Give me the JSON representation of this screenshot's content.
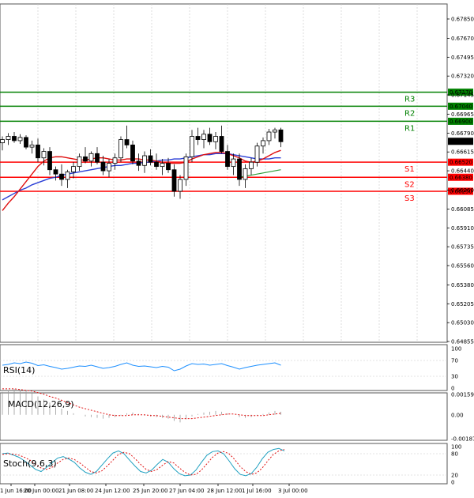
{
  "chart_data": {
    "type": "candlestick",
    "price_axis": {
      "range": [
        0.64855,
        0.67903
      ],
      "ticks": [
        "0.67850",
        "0.67670",
        "0.67495",
        "0.67320",
        "0.67145",
        "0.66965",
        "0.66790",
        "0.66615",
        "0.66440",
        "0.66260",
        "0.66085",
        "0.65910",
        "0.65735",
        "0.65560",
        "0.65380",
        "0.65205",
        "0.65030",
        "0.64855"
      ]
    },
    "time_labels": [
      "1 Jun 16:00",
      "20 Jun 00:00",
      "21 Jun 08:00",
      "24 Jun 12:00",
      "25 Jun 20:00",
      "27 Jun 04:00",
      "28 Jun 12:00",
      "1 Jul 16:00",
      "3 Jul 00:00"
    ],
    "current_price": "0.66714",
    "levels": [
      {
        "name": "R3",
        "value": 0.6717,
        "value_label": "0.67170",
        "color": "#008000"
      },
      {
        "name": "R2",
        "value": 0.6704,
        "value_label": "0.67040",
        "color": "#008000"
      },
      {
        "name": "R1",
        "value": 0.669,
        "value_label": "0.66900",
        "color": "#008000"
      },
      {
        "name": "S1",
        "value": 0.6652,
        "value_label": "0.66520",
        "color": "#ff0000"
      },
      {
        "name": "S2",
        "value": 0.6638,
        "value_label": "0.66380",
        "color": "#ff0000"
      },
      {
        "name": "S3",
        "value": 0.6625,
        "value_label": "0.66250",
        "color": "#ff0000"
      }
    ],
    "candles": [
      {
        "o": 0.667,
        "h": 0.6676,
        "l": 0.6663,
        "c": 0.6673
      },
      {
        "o": 0.6673,
        "h": 0.6679,
        "l": 0.6668,
        "c": 0.6676
      },
      {
        "o": 0.6676,
        "h": 0.668,
        "l": 0.667,
        "c": 0.6672
      },
      {
        "o": 0.6672,
        "h": 0.6678,
        "l": 0.6669,
        "c": 0.6675
      },
      {
        "o": 0.6675,
        "h": 0.6677,
        "l": 0.6664,
        "c": 0.6666
      },
      {
        "o": 0.6666,
        "h": 0.6672,
        "l": 0.666,
        "c": 0.6668
      },
      {
        "o": 0.6668,
        "h": 0.6674,
        "l": 0.6652,
        "c": 0.6656
      },
      {
        "o": 0.6656,
        "h": 0.6665,
        "l": 0.6649,
        "c": 0.6662
      },
      {
        "o": 0.6662,
        "h": 0.6666,
        "l": 0.664,
        "c": 0.6645
      },
      {
        "o": 0.6645,
        "h": 0.6648,
        "l": 0.6635,
        "c": 0.6641
      },
      {
        "o": 0.6641,
        "h": 0.665,
        "l": 0.663,
        "c": 0.6636
      },
      {
        "o": 0.6636,
        "h": 0.6645,
        "l": 0.6628,
        "c": 0.6643
      },
      {
        "o": 0.6643,
        "h": 0.6652,
        "l": 0.6637,
        "c": 0.6648
      },
      {
        "o": 0.6648,
        "h": 0.666,
        "l": 0.6644,
        "c": 0.6657
      },
      {
        "o": 0.6657,
        "h": 0.6666,
        "l": 0.6651,
        "c": 0.6653
      },
      {
        "o": 0.6653,
        "h": 0.6662,
        "l": 0.6648,
        "c": 0.666
      },
      {
        "o": 0.666,
        "h": 0.6666,
        "l": 0.665,
        "c": 0.6652
      },
      {
        "o": 0.6652,
        "h": 0.6658,
        "l": 0.664,
        "c": 0.6644
      },
      {
        "o": 0.6644,
        "h": 0.6655,
        "l": 0.6638,
        "c": 0.6651
      },
      {
        "o": 0.6651,
        "h": 0.666,
        "l": 0.6645,
        "c": 0.6656
      },
      {
        "o": 0.6656,
        "h": 0.6676,
        "l": 0.6652,
        "c": 0.6673
      },
      {
        "o": 0.6673,
        "h": 0.6686,
        "l": 0.6665,
        "c": 0.6668
      },
      {
        "o": 0.6668,
        "h": 0.6672,
        "l": 0.665,
        "c": 0.6653
      },
      {
        "o": 0.6653,
        "h": 0.666,
        "l": 0.6644,
        "c": 0.6649
      },
      {
        "o": 0.6649,
        "h": 0.6662,
        "l": 0.6642,
        "c": 0.6658
      },
      {
        "o": 0.6658,
        "h": 0.6664,
        "l": 0.6649,
        "c": 0.6652
      },
      {
        "o": 0.6652,
        "h": 0.666,
        "l": 0.6645,
        "c": 0.6648
      },
      {
        "o": 0.6648,
        "h": 0.6655,
        "l": 0.664,
        "c": 0.6651
      },
      {
        "o": 0.6651,
        "h": 0.6656,
        "l": 0.6642,
        "c": 0.6645
      },
      {
        "o": 0.6645,
        "h": 0.665,
        "l": 0.662,
        "c": 0.6625
      },
      {
        "o": 0.6625,
        "h": 0.664,
        "l": 0.6618,
        "c": 0.6636
      },
      {
        "o": 0.6636,
        "h": 0.666,
        "l": 0.663,
        "c": 0.6657
      },
      {
        "o": 0.6657,
        "h": 0.6682,
        "l": 0.6652,
        "c": 0.6676
      },
      {
        "o": 0.6676,
        "h": 0.6684,
        "l": 0.6668,
        "c": 0.6673
      },
      {
        "o": 0.6673,
        "h": 0.6682,
        "l": 0.6665,
        "c": 0.6678
      },
      {
        "o": 0.6678,
        "h": 0.6684,
        "l": 0.6668,
        "c": 0.6671
      },
      {
        "o": 0.6671,
        "h": 0.668,
        "l": 0.6664,
        "c": 0.6676
      },
      {
        "o": 0.6676,
        "h": 0.6686,
        "l": 0.666,
        "c": 0.6662
      },
      {
        "o": 0.6662,
        "h": 0.6668,
        "l": 0.6645,
        "c": 0.6648
      },
      {
        "o": 0.6648,
        "h": 0.666,
        "l": 0.664,
        "c": 0.6655
      },
      {
        "o": 0.6655,
        "h": 0.666,
        "l": 0.663,
        "c": 0.6636
      },
      {
        "o": 0.6636,
        "h": 0.665,
        "l": 0.6628,
        "c": 0.6646
      },
      {
        "o": 0.6646,
        "h": 0.6656,
        "l": 0.664,
        "c": 0.6652
      },
      {
        "o": 0.6652,
        "h": 0.667,
        "l": 0.6648,
        "c": 0.6667
      },
      {
        "o": 0.6667,
        "h": 0.6675,
        "l": 0.666,
        "c": 0.6672
      },
      {
        "o": 0.6672,
        "h": 0.6683,
        "l": 0.6668,
        "c": 0.668
      },
      {
        "o": 0.668,
        "h": 0.6684,
        "l": 0.6674,
        "c": 0.6682
      },
      {
        "o": 0.6682,
        "h": 0.6684,
        "l": 0.6666,
        "c": 0.6671
      }
    ],
    "ma_red": [
      0.6607,
      0.6614,
      0.662,
      0.6627,
      0.6634,
      0.6641,
      0.6648,
      0.6653,
      0.6656,
      0.6657,
      0.6657,
      0.6656,
      0.6655,
      0.6654,
      0.6654,
      0.6655,
      0.6656,
      0.6656,
      0.6655,
      0.6654,
      0.6654,
      0.6655,
      0.6655,
      0.6655,
      0.6654,
      0.6654,
      0.6653,
      0.6652,
      0.6651,
      0.6651,
      0.6651,
      0.6652,
      0.6655,
      0.6657,
      0.6659,
      0.666,
      0.6661,
      0.6661,
      0.666,
      0.6658,
      0.6656,
      0.6653,
      0.6652,
      0.6653,
      0.6655,
      0.6658,
      0.6661,
      0.6663
    ],
    "ma_blue": [
      0.6617,
      0.662,
      0.6623,
      0.6626,
      0.6628,
      0.6631,
      0.6633,
      0.6635,
      0.6637,
      0.6638,
      0.664,
      0.6641,
      0.6642,
      0.6643,
      0.6644,
      0.6645,
      0.6646,
      0.6647,
      0.6648,
      0.6649,
      0.6649,
      0.665,
      0.6651,
      0.6651,
      0.6652,
      0.6652,
      0.6653,
      0.6654,
      0.6654,
      0.6655,
      0.6655,
      0.6656,
      0.6657,
      0.6658,
      0.6659,
      0.6659,
      0.666,
      0.666,
      0.666,
      0.6659,
      0.6658,
      0.6657,
      0.6656,
      0.6655,
      0.6655,
      0.6655,
      0.6656,
      0.6656
    ],
    "ma_green": [
      0.6638,
      0.6639,
      0.664,
      0.6641,
      0.6642,
      0.6643,
      0.6644,
      0.6645
    ],
    "rsi": {
      "title": "RSI(14)",
      "range": [
        0,
        100
      ],
      "ticks": [
        "100",
        "70",
        "30",
        "0"
      ],
      "values": [
        58,
        60,
        64,
        62,
        66,
        63,
        57,
        59,
        55,
        52,
        48,
        50,
        53,
        56,
        55,
        58,
        54,
        50,
        52,
        55,
        60,
        64,
        58,
        55,
        56,
        54,
        52,
        55,
        53,
        44,
        48,
        56,
        62,
        60,
        61,
        58,
        60,
        62,
        57,
        53,
        48,
        52,
        55,
        58,
        60,
        62,
        64,
        58
      ]
    },
    "macd": {
      "title": "MACD(12,26,9)",
      "range": [
        -0.001876,
        0.001598
      ],
      "ticks": [
        "0.001598",
        "0.00",
        "-0.001876"
      ],
      "histogram": [
        0.0003,
        0.00032,
        0.00034,
        0.00033,
        0.00031,
        0.00028,
        0.00024,
        0.0002,
        0.00016,
        0.00012,
        8e-05,
        5e-05,
        2e-05,
        0.0,
        -2e-05,
        -3e-05,
        -4e-05,
        -5e-05,
        -4e-05,
        -3e-05,
        -1e-05,
        2e-05,
        3e-05,
        1e-05,
        -1e-05,
        -2e-05,
        -3e-05,
        -4e-05,
        -5e-05,
        -8e-05,
        -0.0001,
        -6e-05,
        -2e-05,
        1e-05,
        3e-05,
        4e-05,
        5e-05,
        4e-05,
        2e-05,
        0.0,
        -3e-05,
        -4e-05,
        -3e-05,
        -1e-05,
        1e-05,
        3e-05,
        5e-05,
        4e-05
      ],
      "signal": [
        0.00034,
        0.00034,
        0.00034,
        0.00033,
        0.00032,
        0.00031,
        0.00029,
        0.00027,
        0.00024,
        0.00022,
        0.00019,
        0.00016,
        0.00013,
        0.0001,
        8e-05,
        6e-05,
        4e-05,
        2e-05,
        0.0,
        -1e-05,
        -1e-05,
        -1e-05,
        0.0,
        0.0,
        0.0,
        -1e-05,
        -1e-05,
        -2e-05,
        -3e-05,
        -4e-05,
        -5e-05,
        -5e-05,
        -5e-05,
        -4e-05,
        -3e-05,
        -2e-05,
        -1e-05,
        0.0,
        1e-05,
        1e-05,
        0.0,
        -1e-05,
        -1e-05,
        -1e-05,
        -1e-05,
        0.0,
        1e-05,
        2e-05
      ]
    },
    "stoch": {
      "title": "Stoch(9,6,3)",
      "range": [
        0,
        100
      ],
      "ticks": [
        "100",
        "80",
        "20",
        "0"
      ],
      "main": [
        80,
        82,
        76,
        70,
        60,
        48,
        36,
        30,
        42,
        55,
        68,
        72,
        65,
        56,
        40,
        28,
        22,
        30,
        48,
        66,
        82,
        88,
        80,
        62,
        45,
        30,
        26,
        34,
        50,
        64,
        56,
        38,
        24,
        18,
        20,
        34,
        56,
        76,
        86,
        88,
        80,
        60,
        38,
        22,
        18,
        24,
        42,
        66,
        84,
        92,
        95,
        88
      ],
      "signal": [
        78,
        80,
        79,
        76,
        70,
        62,
        50,
        40,
        36,
        42,
        54,
        64,
        68,
        64,
        54,
        42,
        30,
        26,
        32,
        46,
        62,
        78,
        84,
        80,
        66,
        50,
        36,
        30,
        36,
        48,
        58,
        54,
        40,
        28,
        20,
        22,
        34,
        52,
        70,
        82,
        86,
        80,
        64,
        44,
        30,
        22,
        26,
        40,
        60,
        78,
        88,
        92
      ]
    }
  }
}
